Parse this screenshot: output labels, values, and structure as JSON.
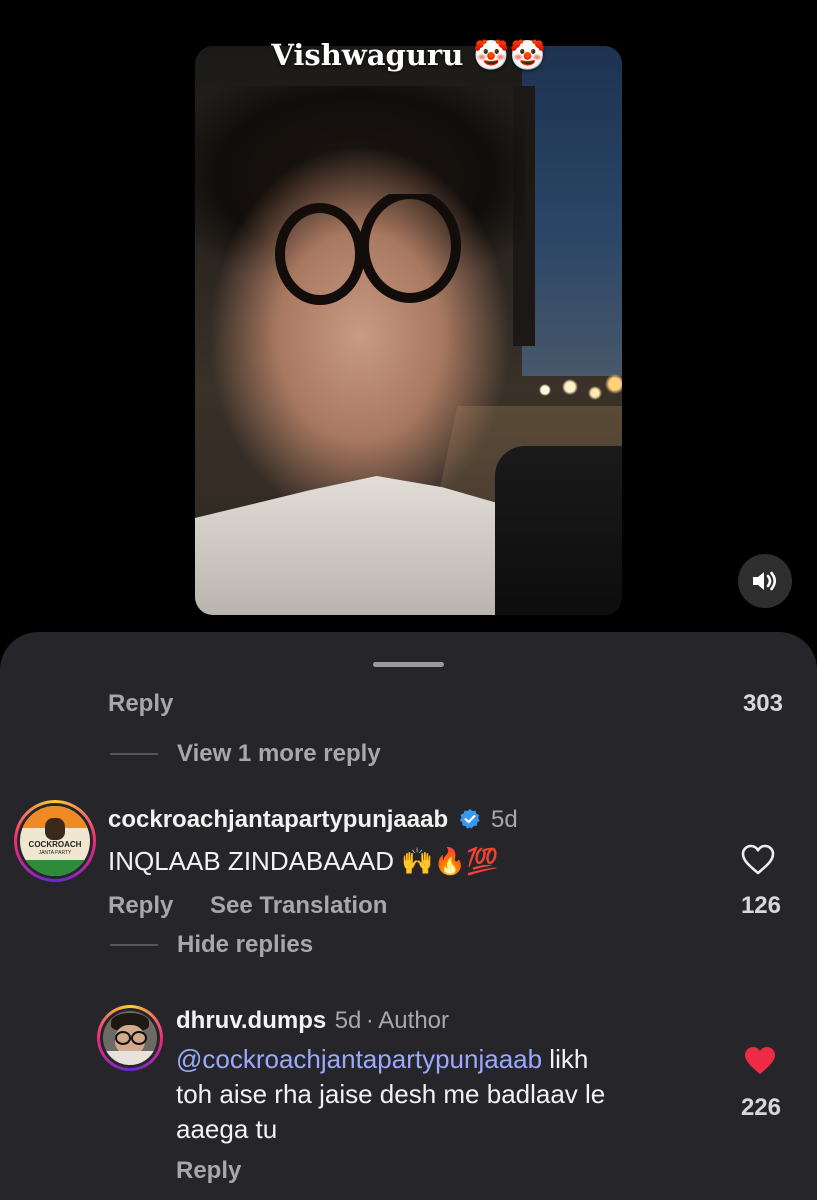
{
  "video": {
    "caption": "Vishwaguru",
    "caption_emoji": "🤡🤡",
    "mute_icon": "speaker-icon"
  },
  "thread": {
    "reply_label": "Reply",
    "top_like_count": "303",
    "view_more_label": "View 1 more reply"
  },
  "comments": [
    {
      "username": "cockroachjantapartypunjaaab",
      "verified": true,
      "time": "5d",
      "text": "INQLAAB ZINDABAAAD",
      "emoji": "🙌🔥💯",
      "reply_label": "Reply",
      "translate_label": "See Translation",
      "like_count": "126",
      "liked": false,
      "hide_replies_label": "Hide replies",
      "avatar_lines": [
        "Punjab",
        "COCKROACH",
        "JANTA PARTY"
      ]
    },
    {
      "username": "dhruv.dumps",
      "time": "5d",
      "separator": "·",
      "author_label": "Author",
      "mention": "@cockroachjantapartypunjaaab",
      "text_line1_rest": " likh",
      "text_line2": "toh aise rha jaise desh me badlaav le",
      "text_line3": "aaega tu",
      "reply_label": "Reply",
      "like_count": "226",
      "liked": true
    }
  ],
  "colors": {
    "sheet_bg": "#26262a",
    "mention": "#9aa9ff",
    "heart_liked": "#ed2b47",
    "verified": "#3897f0"
  }
}
